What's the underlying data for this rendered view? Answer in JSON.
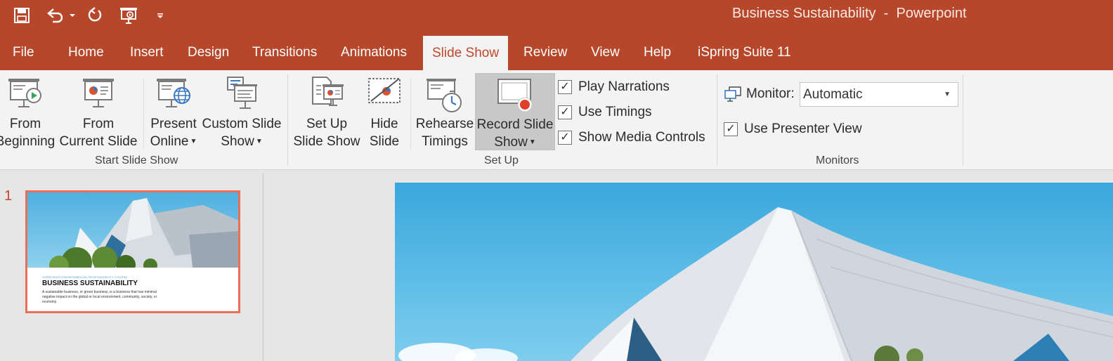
{
  "window": {
    "title": "Business Sustainability  -  Powerpoint"
  },
  "qat": {
    "icons": [
      "save-icon",
      "undo-icon",
      "undo-dropdown-icon",
      "redo-icon",
      "start-from-beginning-icon",
      "customize-qat-icon"
    ]
  },
  "tabs": [
    "File",
    "Home",
    "Insert",
    "Design",
    "Transitions",
    "Animations",
    "Slide Show",
    "Review",
    "View",
    "Help",
    "iSpring Suite 11"
  ],
  "active_tab": "Slide Show",
  "ribbon": {
    "start_slide_show": {
      "label": "Start Slide Show",
      "from_beginning": [
        "From",
        "Beginning"
      ],
      "from_current": [
        "From",
        "Current Slide"
      ],
      "present_online": [
        "Present",
        "Online"
      ],
      "custom_slide_show": [
        "Custom Slide",
        "Show"
      ]
    },
    "set_up": {
      "label": "Set Up",
      "set_up_slide_show": [
        "Set Up",
        "Slide Show"
      ],
      "hide_slide": [
        "Hide",
        "Slide"
      ],
      "rehearse_timings": [
        "Rehearse",
        "Timings"
      ],
      "record_slide_show": [
        "Record Slide",
        "Show"
      ],
      "play_narrations": "Play Narrations",
      "use_timings": "Use Timings",
      "show_media_controls": "Show Media Controls"
    },
    "monitors": {
      "label": "Monitors",
      "monitor_label": "Monitor:",
      "monitor_value": "Automatic",
      "use_presenter_view": "Use Presenter View"
    }
  },
  "checkboxes": {
    "play_narrations": true,
    "use_timings": true,
    "show_media_controls": true,
    "use_presenter_view": true
  },
  "slides": [
    {
      "number": "1",
      "tagline": "CORPORATE ENVIRONMENTAL RESPONSIBILITY COURSE",
      "title": "BUSINESS SUSTAINABILITY",
      "description": "A sustainable business, or green business, is a business that has minimal negative impact on the global or local environment, community, society, or economy."
    }
  ],
  "colors": {
    "brand": "#b7472a",
    "active_tab_text": "#c0472b",
    "selected_slide_border": "#e97055"
  }
}
